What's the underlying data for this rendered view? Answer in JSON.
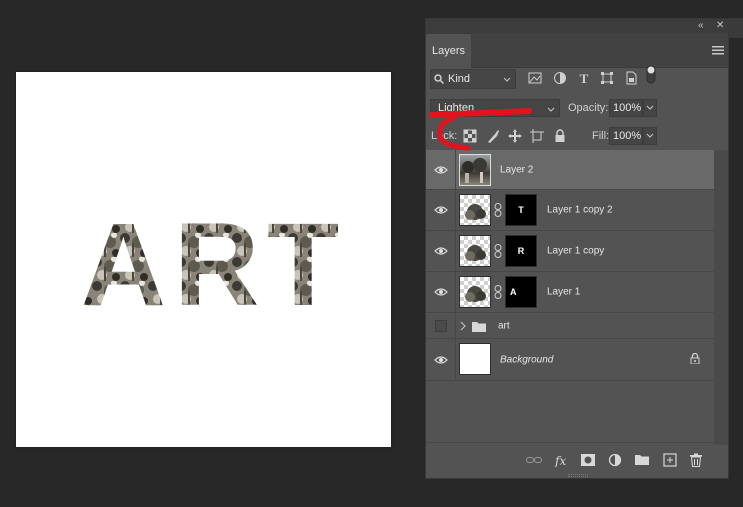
{
  "canvas": {
    "art_text": "ART"
  },
  "panel": {
    "tab_label": "Layers",
    "collapse_icon": "double-chevron-left-icon",
    "close_icon": "close-icon",
    "menu_icon": "hamburger-menu-icon",
    "filter": {
      "kind_label": "Kind"
    },
    "blend_mode": "Lighten",
    "opacity_label": "Opacity:",
    "opacity_value": "100%",
    "lock_label": "Lock:",
    "fill_label": "Fill:",
    "fill_value": "100%"
  },
  "layers": [
    {
      "name": "Layer 2",
      "selected": true
    },
    {
      "name": "Layer 1 copy 2",
      "mask_letter": "T"
    },
    {
      "name": "Layer 1 copy",
      "mask_letter": "R"
    },
    {
      "name": "Layer 1",
      "mask_letter": "A"
    },
    {
      "name": "art",
      "type": "group"
    },
    {
      "name": "Background",
      "locked": true
    }
  ],
  "colors": {
    "annotation": "#e0141e",
    "selected_row": "#696969",
    "panel_bg": "#535353",
    "app_bg": "#282828"
  }
}
